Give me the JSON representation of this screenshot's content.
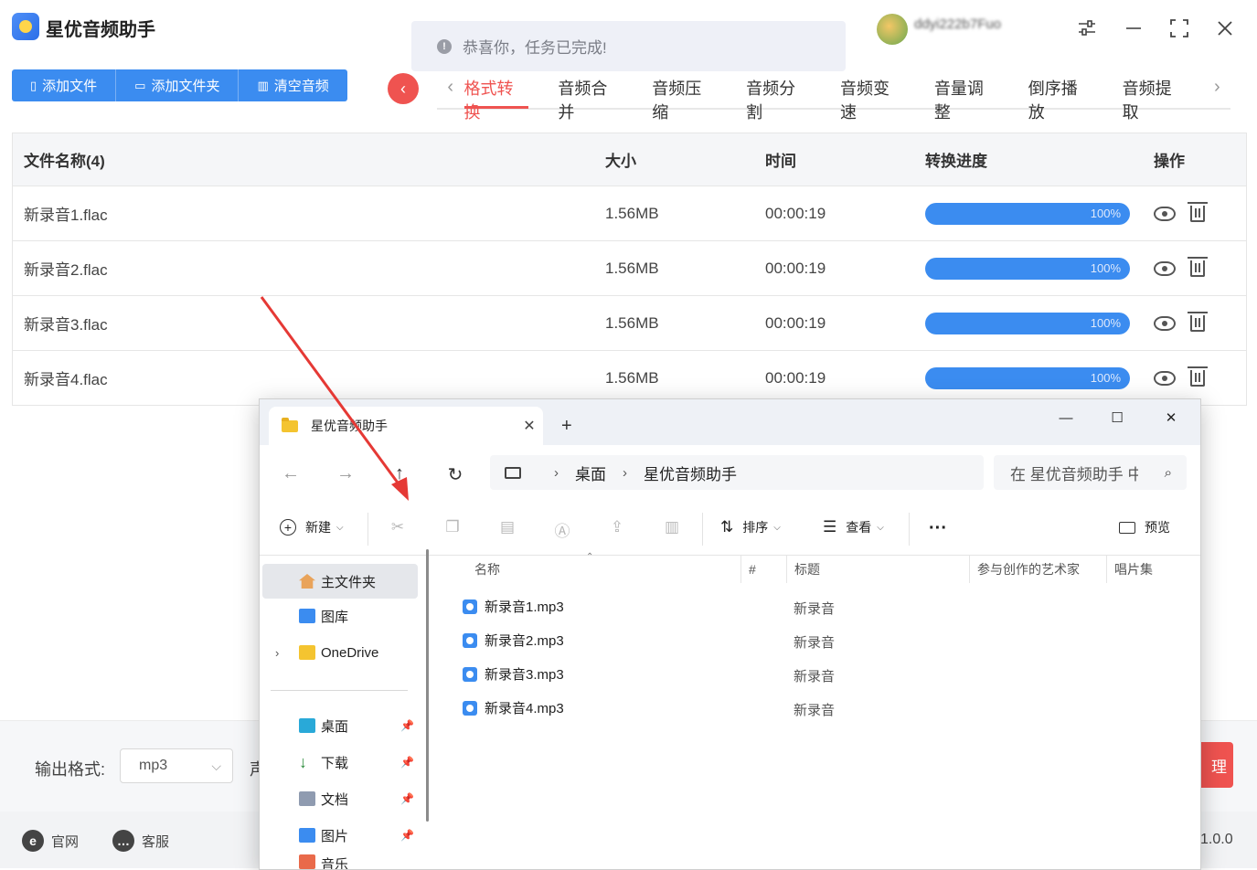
{
  "app": {
    "title": "星优音频助手",
    "notice": "恭喜你，任务已完成!",
    "user_name": "ddyi222b7Fuo",
    "toolbar": [
      {
        "label": "添加文件",
        "icon": "file-icon"
      },
      {
        "label": "添加文件夹",
        "icon": "folder-icon"
      },
      {
        "label": "清空音频",
        "icon": "trash-icon"
      }
    ],
    "tabs": [
      "格式转换",
      "音频合并",
      "音频压缩",
      "音频分割",
      "音频变速",
      "音量调整",
      "倒序播放",
      "音频提取"
    ],
    "active_tab": "格式转换",
    "table": {
      "headers": {
        "name": "文件名称(4)",
        "size": "大小",
        "time": "时间",
        "progress": "转换进度",
        "ops": "操作"
      },
      "rows": [
        {
          "name": "新录音1.flac",
          "size": "1.56MB",
          "time": "00:00:19",
          "progress": "100%"
        },
        {
          "name": "新录音2.flac",
          "size": "1.56MB",
          "time": "00:00:19",
          "progress": "100%"
        },
        {
          "name": "新录音3.flac",
          "size": "1.56MB",
          "time": "00:00:19",
          "progress": "100%"
        },
        {
          "name": "新录音4.flac",
          "size": "1.56MB",
          "time": "00:00:19",
          "progress": "100%"
        }
      ]
    },
    "output_label": "输出格式:",
    "output_value": "mp3",
    "partial_label": "声",
    "process_button": "理",
    "footer": {
      "site": "官网",
      "support": "客服",
      "version": "1.0.0"
    },
    "colors": {
      "accent": "#3b8cf0",
      "danger": "#ef5350"
    }
  },
  "explorer": {
    "tab_title": "星优音频助手",
    "breadcrumb": [
      "桌面",
      "星优音频助手"
    ],
    "search_placeholder": "在 星优音频助手 中",
    "commands": {
      "new": "新建",
      "sort": "排序",
      "view": "查看",
      "preview": "预览"
    },
    "sidebar": [
      {
        "label": "主文件夹",
        "icon": "home-icon",
        "selected": true
      },
      {
        "label": "图库",
        "icon": "gallery-icon"
      },
      {
        "label": "OneDrive",
        "icon": "folder-icon"
      },
      {
        "label": "桌面",
        "icon": "desktop-icon",
        "pinned": true
      },
      {
        "label": "下载",
        "icon": "download-icon",
        "pinned": true
      },
      {
        "label": "文档",
        "icon": "document-icon",
        "pinned": true
      },
      {
        "label": "图片",
        "icon": "picture-icon",
        "pinned": true
      },
      {
        "label": "音乐",
        "icon": "music-icon",
        "pinned": true
      }
    ],
    "columns": [
      "名称",
      "#",
      "标题",
      "参与创作的艺术家",
      "唱片集"
    ],
    "files": [
      {
        "name": "新录音1.mp3",
        "title": "新录音"
      },
      {
        "name": "新录音2.mp3",
        "title": "新录音"
      },
      {
        "name": "新录音3.mp3",
        "title": "新录音"
      },
      {
        "name": "新录音4.mp3",
        "title": "新录音"
      }
    ]
  }
}
